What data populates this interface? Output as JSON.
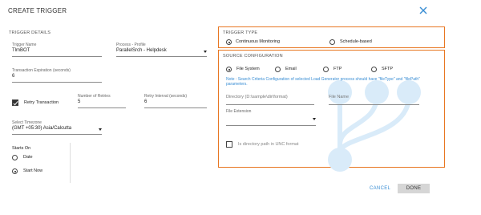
{
  "dialog": {
    "title": "CREATE TRIGGER",
    "cancel_label": "CANCEL",
    "done_label": "DONE"
  },
  "trigger_details": {
    "section_title": "TRIGGER DETAILS",
    "trigger_name_label": "Trigger Name",
    "trigger_name_value": "TlmBOT",
    "process_profile_label": "Process - Profile",
    "process_profile_value": "ParallelSrch - Helpdesk",
    "transaction_expiration_label": "Transaction Expiration (seconds)",
    "transaction_expiration_value": "6",
    "retry_transaction_label": "Retry Transaction",
    "retry_transaction_checked": true,
    "number_of_retries_label": "Number of Retries",
    "number_of_retries_value": "5",
    "retry_interval_label": "Retry Interval (seconds)",
    "retry_interval_value": "6",
    "timezone_label": "Select Timezone",
    "timezone_value": "(GMT +05:30) Asia/Calcutta",
    "starts_on_label": "Starts On",
    "starts_on_options": [
      "Date",
      "Start Now"
    ],
    "starts_on_selected": "Start Now"
  },
  "trigger_type": {
    "section_title": "TRIGGER TYPE",
    "options": [
      "Continuous Monitoring",
      "Schedule-based"
    ],
    "selected": "Continuous Monitoring"
  },
  "source_configuration": {
    "section_title": "SOURCE CONFIGURATION",
    "options": [
      "File System",
      "Email",
      "FTP",
      "SFTP"
    ],
    "selected": "File System",
    "note": "Note : Search Criteria Configuration of selected Load Generator process should have \"fileType\" and \"filePath\" parameters.",
    "directory_placeholder": "Directory (D:\\sample\\dir\\format)",
    "file_name_placeholder": "File Name",
    "file_extension_label": "File Extension",
    "unc_label": "Is directory path in UNC format",
    "unc_checked": false
  },
  "colors": {
    "highlight_border": "#e87722",
    "link": "#3a8ed4",
    "overlay_circle": "#d9ebf9",
    "done_button": "#d6d6d6"
  },
  "icons": {
    "close": "close-icon",
    "dropdown": "chevron-down-icon"
  }
}
